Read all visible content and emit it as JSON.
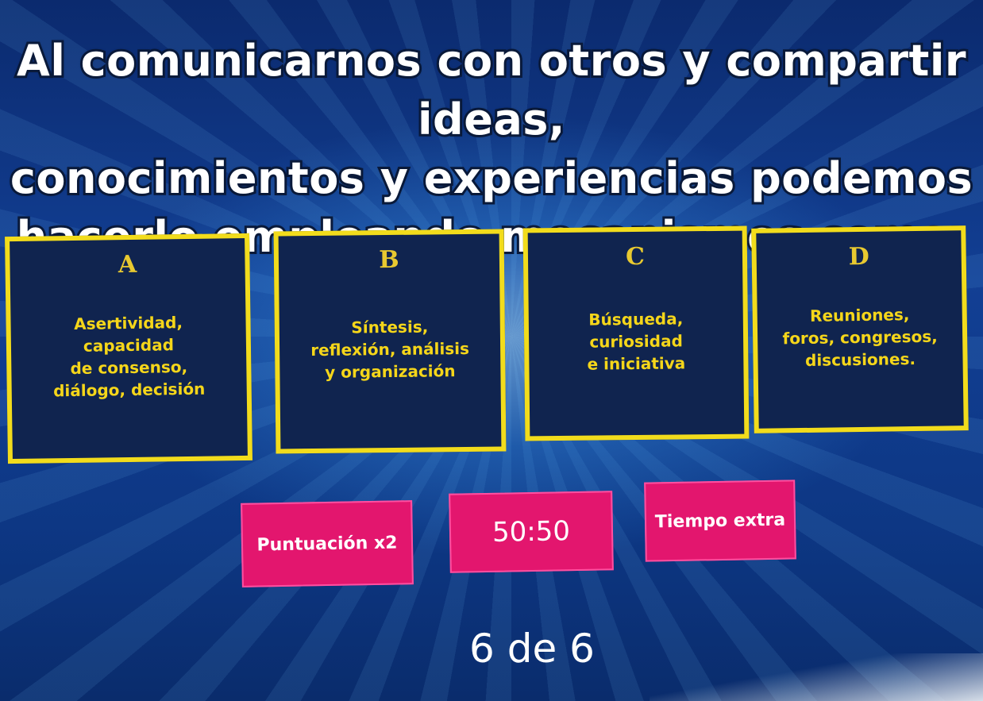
{
  "question": {
    "line1": "Al comunicarnos con otros y compartir ideas,",
    "line2": "conocimientos y experiencias podemos",
    "line3": "hacerlo empleando mecanismos como:"
  },
  "answers": [
    {
      "letter": "A",
      "text": "Asertividad,\ncapacidad\nde consenso,\ndiálogo, decisión"
    },
    {
      "letter": "B",
      "text": "Síntesis,\nreflexión, análisis\ny organización"
    },
    {
      "letter": "C",
      "text": "Búsqueda,\ncuriosidad\ne iniciativa"
    },
    {
      "letter": "D",
      "text": "Reuniones,\nforos, congresos,\ndiscusiones."
    }
  ],
  "powerups": {
    "double_points": "Puntuación x2",
    "fifty_fifty": "50:50",
    "extra_time": "Tiempo extra"
  },
  "progress": "6 de 6",
  "colors": {
    "answer_border": "#f2dc1c",
    "answer_text": "#f5d61a",
    "answer_background": "#10244f",
    "powerup_background": "#e3166e"
  }
}
